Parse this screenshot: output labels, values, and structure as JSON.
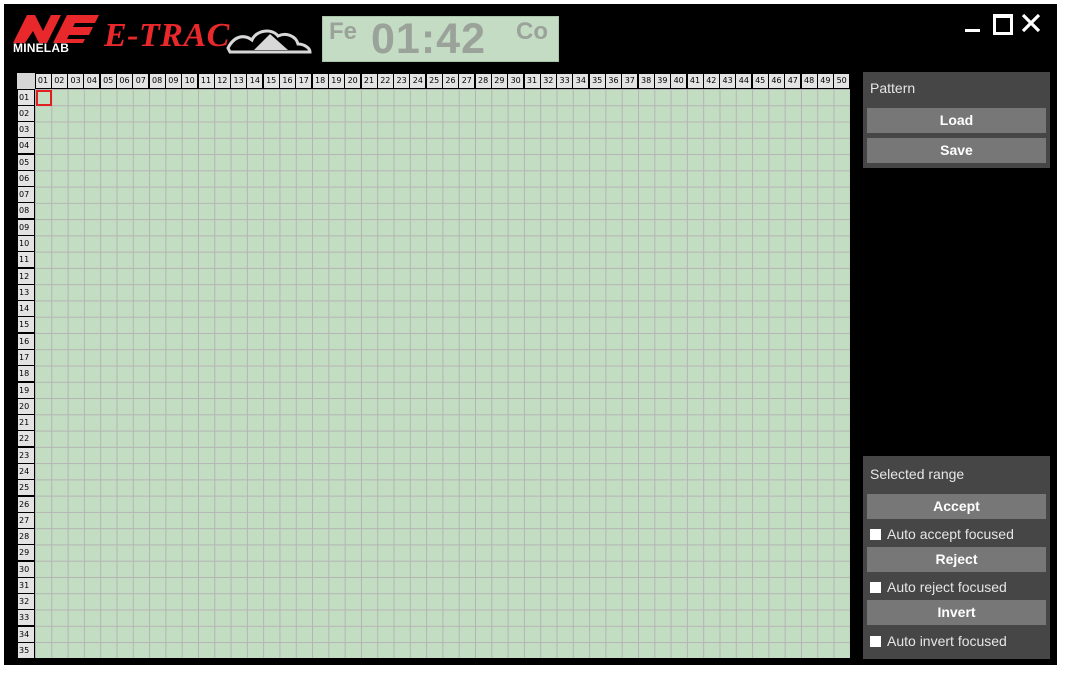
{
  "header": {
    "brand": "MINELAB",
    "product": "E-TRAC",
    "lcd": {
      "left": "Fe",
      "time": "01:42",
      "right": "Co"
    }
  },
  "window_controls": {
    "minimize": "minimize-icon",
    "maximize": "maximize-icon",
    "close": "close-icon"
  },
  "grid": {
    "columns": [
      "01",
      "02",
      "03",
      "04",
      "05",
      "06",
      "07",
      "08",
      "09",
      "10",
      "11",
      "12",
      "13",
      "14",
      "15",
      "16",
      "17",
      "18",
      "19",
      "20",
      "21",
      "22",
      "23",
      "24",
      "25",
      "26",
      "27",
      "28",
      "29",
      "30",
      "31",
      "32",
      "33",
      "34",
      "35",
      "36",
      "37",
      "38",
      "39",
      "40",
      "41",
      "42",
      "43",
      "44",
      "45",
      "46",
      "47",
      "48",
      "49",
      "50"
    ],
    "rows": [
      "01",
      "02",
      "03",
      "04",
      "05",
      "06",
      "07",
      "08",
      "09",
      "10",
      "11",
      "12",
      "13",
      "14",
      "15",
      "16",
      "17",
      "18",
      "19",
      "20",
      "21",
      "22",
      "23",
      "24",
      "25",
      "26",
      "27",
      "28",
      "29",
      "30",
      "31",
      "32",
      "33",
      "34",
      "35"
    ],
    "focused_cell": "01,01",
    "cell_color": "#c3ddc3",
    "focus_color": "#e02020"
  },
  "pattern_panel": {
    "title": "Pattern",
    "load": "Load",
    "save": "Save"
  },
  "range_panel": {
    "title": "Selected range",
    "accept": "Accept",
    "auto_accept": "Auto accept focused",
    "reject": "Reject",
    "auto_reject": "Auto reject focused",
    "invert": "Invert",
    "auto_invert": "Auto invert focused"
  }
}
